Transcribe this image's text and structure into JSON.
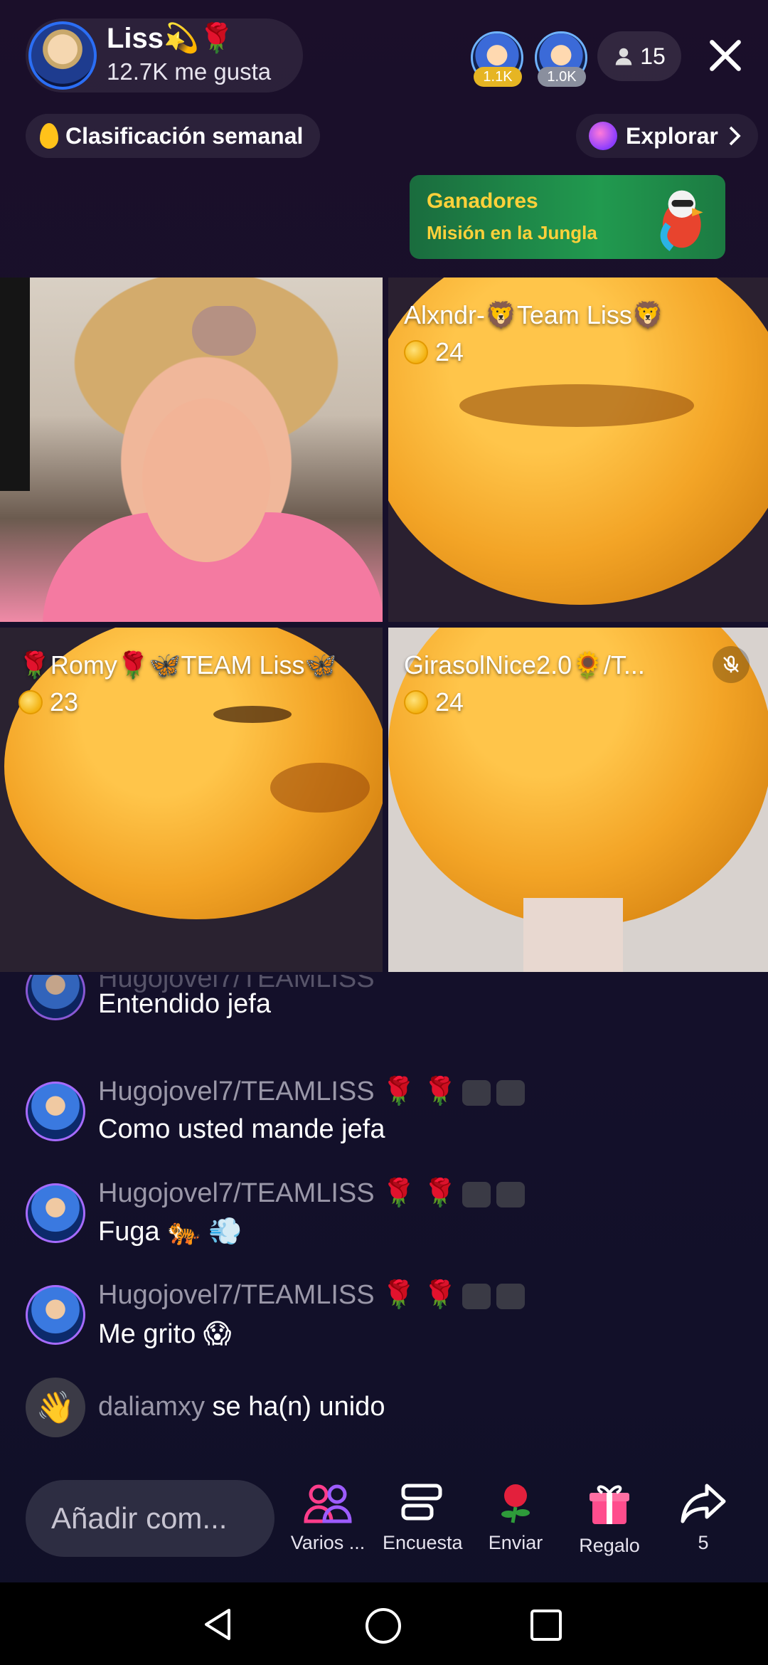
{
  "header": {
    "host_name": "Liss💫🌹",
    "likes": "12.7K me gusta",
    "top_viewers": [
      {
        "count": "1.1K",
        "color": "#e6b523"
      },
      {
        "count": "1.0K",
        "color": "#8a8f9e"
      }
    ],
    "viewer_count": "15",
    "rank_label": "Clasificación semanal",
    "explore_label": "Explorar",
    "banner": {
      "title": "Ganadores",
      "subtitle": "Misión en la Jungla"
    }
  },
  "guests": [
    {
      "name": "Alxndr-🦁Team Liss🦁",
      "coins": "24"
    },
    {
      "name": "🌹Romy🌹🦋TEAM Liss🦋",
      "coins": "23"
    },
    {
      "name": "GirasolNice2.0🌻/T...",
      "coins": "24"
    }
  ],
  "chat": [
    {
      "user": "Hugojovel7/TEAMLISS",
      "message": "Entendido jefa"
    },
    {
      "user": "Hugojovel7/TEAMLISS",
      "message": "Como usted mande jefa"
    },
    {
      "user": "Hugojovel7/TEAMLISS",
      "message": "Fuga 🐅 💨"
    },
    {
      "user": "Hugojovel7/TEAMLISS",
      "message": "Me grito 😱"
    }
  ],
  "join": {
    "user": "daliamxy",
    "text": "se ha(n) unido"
  },
  "bottom": {
    "comment_placeholder": "Añadir com...",
    "actions": [
      {
        "label": "Varios ...",
        "icon": "multi-guest-icon"
      },
      {
        "label": "Encuesta",
        "icon": "poll-icon"
      },
      {
        "label": "Enviar",
        "icon": "rose-icon"
      },
      {
        "label": "Regalo",
        "icon": "gift-icon"
      },
      {
        "label": "5",
        "icon": "share-icon"
      }
    ]
  },
  "colors": {
    "accent_pink": "#fe2c55",
    "banner_text": "#ffd13a"
  }
}
